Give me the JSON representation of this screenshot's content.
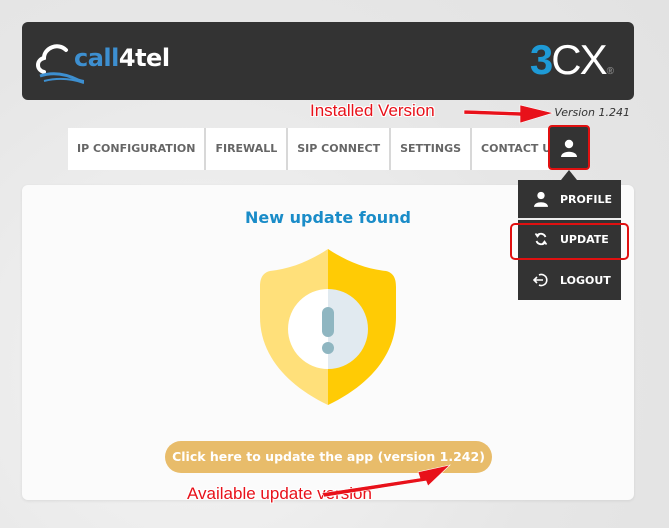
{
  "header": {
    "brand_left_prefix": "call",
    "brand_left_suffix": "4tel",
    "brand_right_number": "3",
    "brand_right_letters": "CX",
    "brand_right_mark": "®"
  },
  "version_label": "Version 1.241",
  "nav": {
    "items": [
      {
        "label": "IP CONFIGURATION"
      },
      {
        "label": "FIREWALL"
      },
      {
        "label": "SIP CONNECT"
      },
      {
        "label": "SETTINGS"
      },
      {
        "label": "CONTACT US"
      }
    ],
    "user_icon": "user-icon"
  },
  "dropdown": {
    "items": [
      {
        "label": "PROFILE",
        "icon": "user-icon"
      },
      {
        "label": "UPDATE",
        "icon": "refresh-icon"
      },
      {
        "label": "LOGOUT",
        "icon": "logout-icon"
      }
    ]
  },
  "card": {
    "title": "New update found",
    "icon": "shield-warning-icon",
    "button_label": "Click here to update the app (version 1.242)"
  },
  "annotations": {
    "installed": "Installed Version",
    "available": "Available update version"
  },
  "colors": {
    "header_bg": "#333333",
    "accent_blue": "#1a8cc8",
    "button_gold": "#e8bc6a",
    "annotation_red": "#e8111a"
  }
}
